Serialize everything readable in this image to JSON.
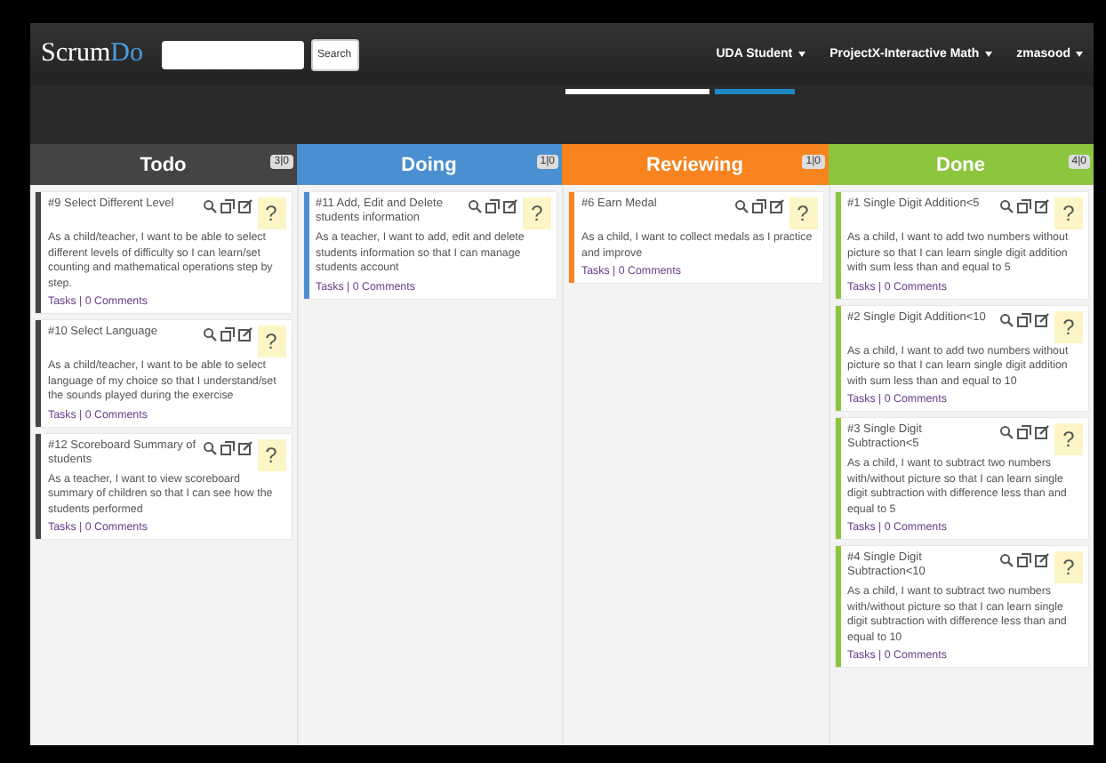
{
  "nav": {
    "logo": {
      "main": "Scrum",
      "accent": "Do"
    },
    "search": {
      "button": "Search"
    },
    "menus": [
      "UDA Student",
      "ProjectX-Interactive Math",
      "zmasood"
    ]
  },
  "columns": [
    {
      "title": "Todo",
      "count": "3|0",
      "color": "#444444",
      "cards": [
        {
          "title": "#9 Select Different Level",
          "help": "?",
          "text": "As a child/teacher, I want to be able to select different levels of difficulty so I can learn/set counting and mathematical operations step by step.",
          "links": "Tasks | 0 Comments"
        },
        {
          "title": "#10 Select Language",
          "help": "?",
          "text": "As a child/teacher, I want to be able to select language of my choice so that I understand/set the sounds played during the exercise",
          "links": "Tasks | 0 Comments"
        },
        {
          "title": "#12 Scoreboard Summary of students",
          "help": "?",
          "text": "As a teacher, I want to view scoreboard summary of children so that I can see how the students performed",
          "links": "Tasks | 0 Comments"
        }
      ]
    },
    {
      "title": "Doing",
      "count": "1|0",
      "color": "#4a8fd0",
      "cards": [
        {
          "title": "#11 Add, Edit and Delete students information",
          "help": "?",
          "text": "As a teacher, I want to add, edit and delete students information so that I can manage students account",
          "links": "Tasks | 0 Comments"
        }
      ]
    },
    {
      "title": "Reviewing",
      "count": "1|0",
      "color": "#f7841e",
      "cards": [
        {
          "title": "#6 Earn Medal",
          "help": "?",
          "text": "As a child, I want to collect medals as I practice and improve",
          "links": "Tasks | 0 Comments"
        }
      ]
    },
    {
      "title": "Done",
      "count": "4|0",
      "color": "#8cc63f",
      "cards": [
        {
          "title": "#1 Single Digit Addition<5",
          "help": "?",
          "text": "As a child, I want to add two numbers without picture so that I can learn single digit addition with sum less than and equal to 5",
          "links": "Tasks | 0 Comments"
        },
        {
          "title": "#2 Single Digit Addition<10",
          "help": "?",
          "text": "As a child, I want to add two numbers without picture so that I can learn single digit addition with sum less than and equal to 10",
          "links": "Tasks | 0 Comments"
        },
        {
          "title": "#3 Single Digit Subtraction<5",
          "help": "?",
          "text": "As a child, I want to subtract two numbers with/without picture so that I can learn single digit subtraction with difference less than and equal to 5",
          "links": "Tasks | 0 Comments"
        },
        {
          "title": "#4 Single Digit Subtraction<10",
          "help": "?",
          "text": "As a child, I want to subtract two numbers with/without picture so that I can learn single digit subtraction with difference less than and equal to 10",
          "links": "Tasks | 0 Comments"
        }
      ]
    }
  ]
}
